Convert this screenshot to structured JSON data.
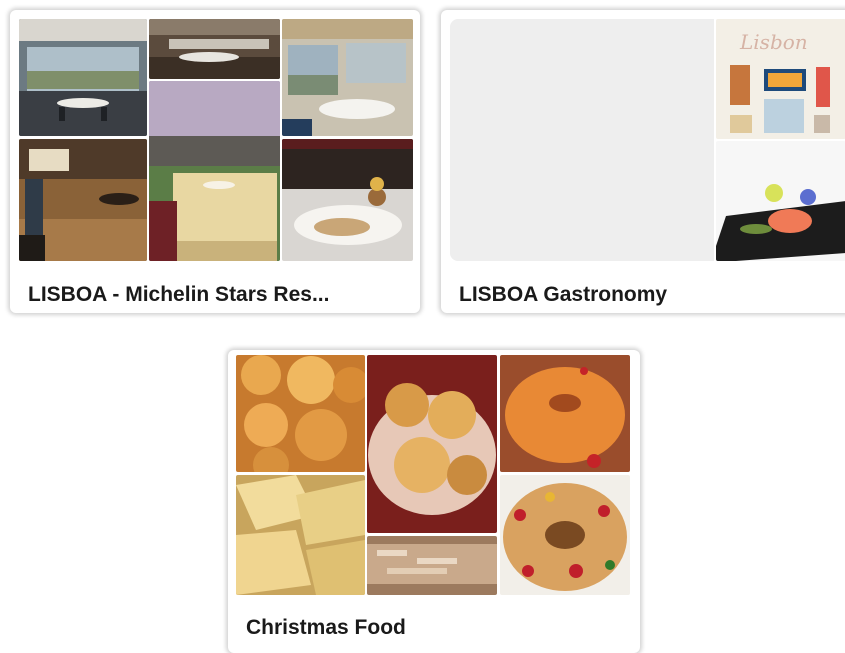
{
  "boards": [
    {
      "title": "LISBOA - Michelin Stars Res...",
      "images": [
        "restaurant-dining-room-window-view",
        "restaurant-long-dining-hall",
        "dining-table-by-sea-window",
        "restaurant-wooden-floor-waiter",
        "table-at-sunset-terrace",
        "plated-dish-with-flowers"
      ]
    },
    {
      "title": "LISBOA Gastronomy",
      "images": [
        "empty-placeholder",
        "sardine-cans-flat-lay",
        "plated-fish-appetizer"
      ]
    },
    {
      "title": "Christmas Food",
      "images": [
        "sonhos-fried-dough",
        "rabanadas-sugar-fritters",
        "orange-ring-cake",
        "fried-pastry-coscorões",
        "almond-tart",
        "bolo-rei-king-cake"
      ]
    }
  ],
  "colors": {
    "title_text": "#1a1a1a",
    "placeholder": "#eeeeee",
    "shadow": "#c8c8c8"
  }
}
